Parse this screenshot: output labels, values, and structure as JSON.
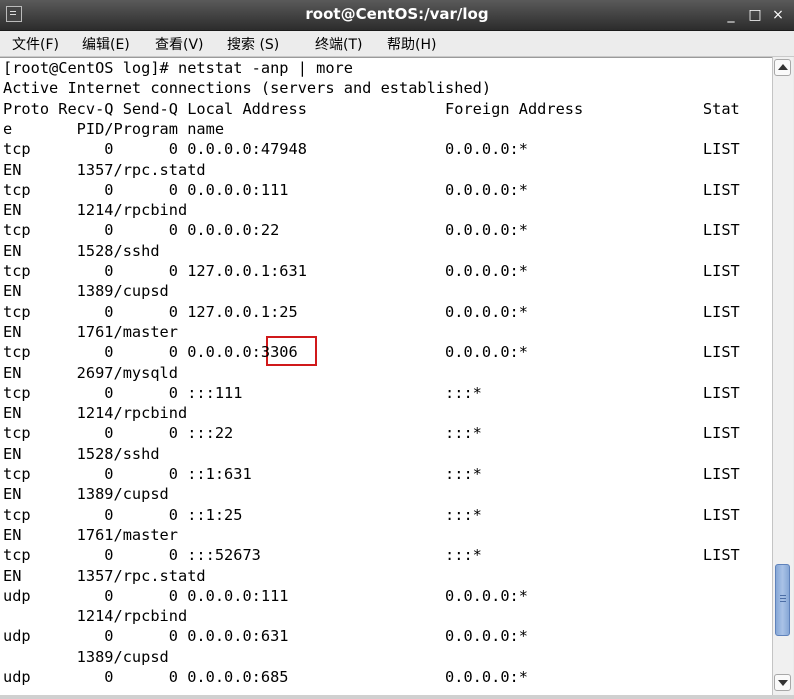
{
  "window": {
    "title": "root@CentOS:/var/log",
    "icons": {
      "app": "terminal-icon",
      "minimize": "minimize-icon",
      "maximize": "maximize-icon",
      "close": "close-icon"
    },
    "controls": {
      "minimize": "_",
      "maximize": "□",
      "close": "×"
    }
  },
  "menu": [
    {
      "label": "文件(F)"
    },
    {
      "label": "编辑(E)"
    },
    {
      "label": "查看(V)"
    },
    {
      "label": "搜索 (S)"
    },
    {
      "label": "终端(T)"
    },
    {
      "label": "帮助(H)"
    }
  ],
  "terminal": {
    "lines": [
      "[root@CentOS log]# netstat -anp | more",
      "Active Internet connections (servers and established)",
      "Proto Recv-Q Send-Q Local Address               Foreign Address             Stat",
      "e       PID/Program name",
      "tcp        0      0 0.0.0.0:47948               0.0.0.0:*                   LIST",
      "EN      1357/rpc.statd",
      "tcp        0      0 0.0.0.0:111                 0.0.0.0:*                   LIST",
      "EN      1214/rpcbind",
      "tcp        0      0 0.0.0.0:22                  0.0.0.0:*                   LIST",
      "EN      1528/sshd",
      "tcp        0      0 127.0.0.1:631               0.0.0.0:*                   LIST",
      "EN      1389/cupsd",
      "tcp        0      0 127.0.0.1:25                0.0.0.0:*                   LIST",
      "EN      1761/master",
      "tcp        0      0 0.0.0.0:3306                0.0.0.0:*                   LIST",
      "EN      2697/mysqld",
      "tcp        0      0 :::111                      :::*                        LIST",
      "EN      1214/rpcbind",
      "tcp        0      0 :::22                       :::*                        LIST",
      "EN      1528/sshd",
      "tcp        0      0 ::1:631                     :::*                        LIST",
      "EN      1389/cupsd",
      "tcp        0      0 ::1:25                      :::*                        LIST",
      "EN      1761/master",
      "tcp        0      0 :::52673                    :::*                        LIST",
      "EN      1357/rpc.statd",
      "udp        0      0 0.0.0.0:111                 0.0.0.0:*",
      "        1214/rpcbind",
      "udp        0      0 0.0.0.0:631                 0.0.0.0:*",
      "        1389/cupsd",
      "udp        0      0 0.0.0.0:685                 0.0.0.0:*"
    ],
    "highlighted_value": "3306",
    "highlight_color": "#d0191b"
  },
  "scrollbar": {
    "thumb_color": "#86a7d6",
    "position_fraction": 0.93
  }
}
